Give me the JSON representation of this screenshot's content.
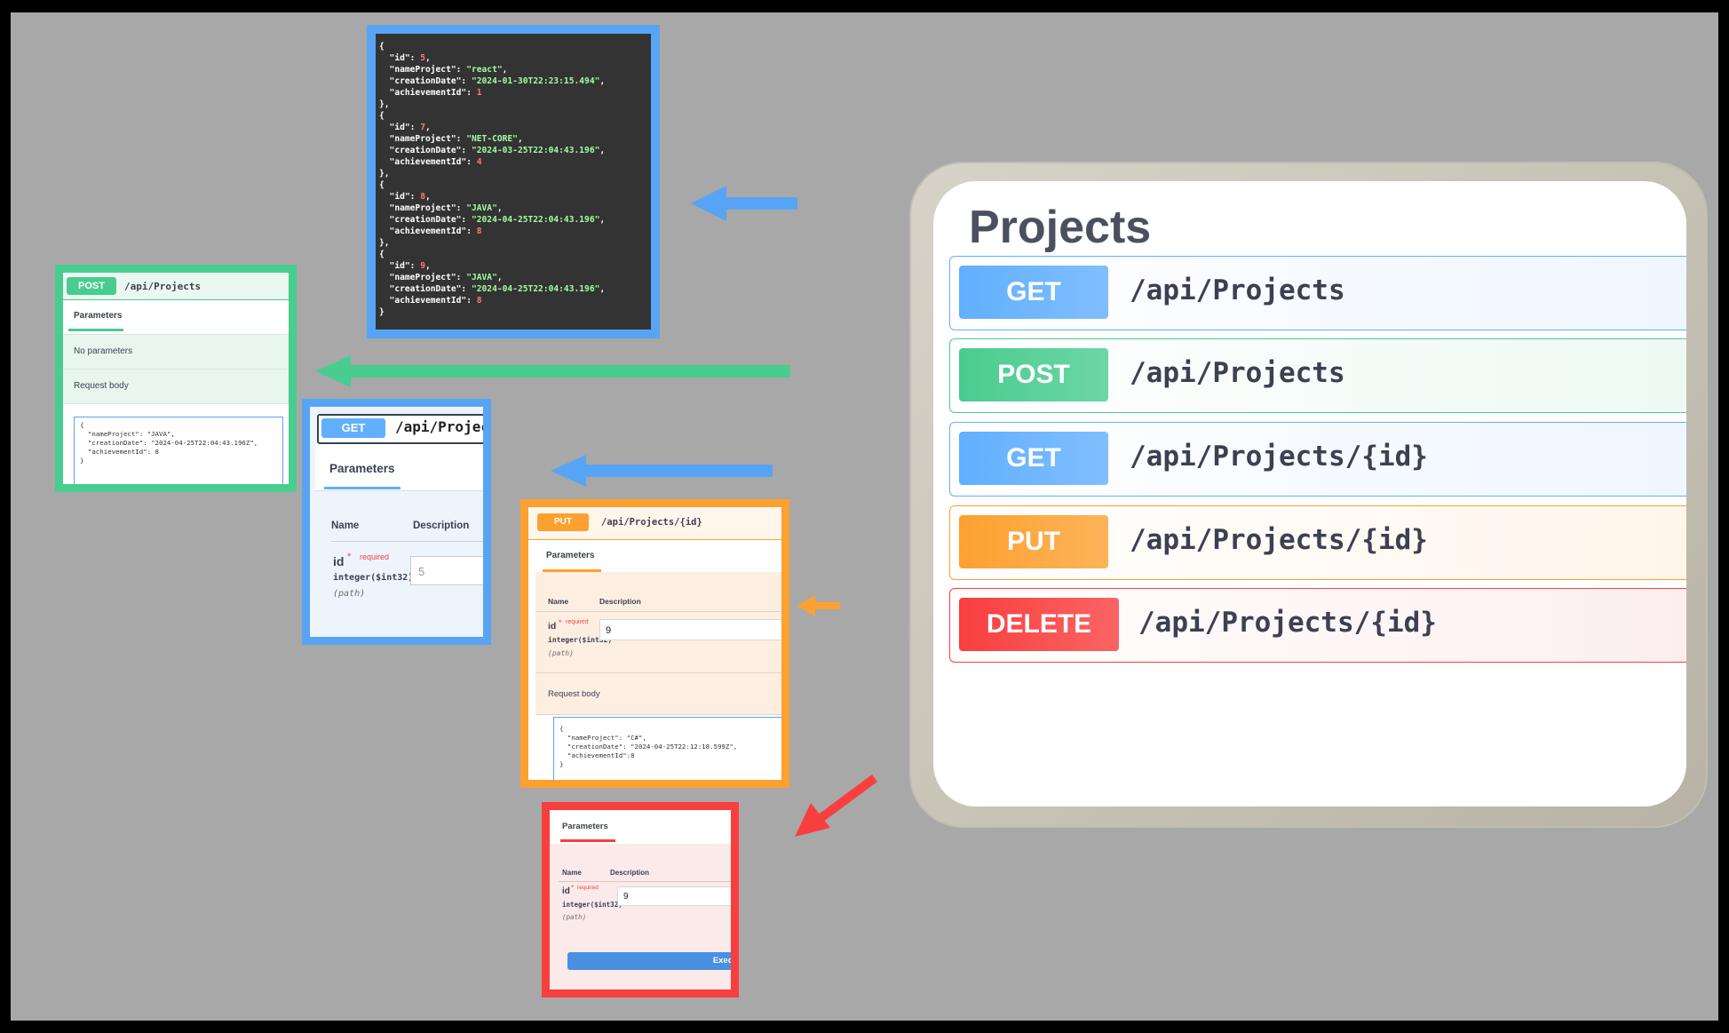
{
  "json_response": {
    "items": [
      {
        "id": "5",
        "nameProject": "\"react\"",
        "creationDate": "\"2024-01-30T22:23:15.494\"",
        "achievementId": "1"
      },
      {
        "id": "7",
        "nameProject": "\"NET-CORE\"",
        "creationDate": "\"2024-03-25T22:04:43.196\"",
        "achievementId": "4"
      },
      {
        "id": "8",
        "nameProject": "\"JAVA\"",
        "creationDate": "\"2024-04-25T22:04:43.196\"",
        "achievementId": "8"
      },
      {
        "id": "9",
        "nameProject": "\"JAVA\"",
        "creationDate": "\"2024-04-25T22:04:43.196\"",
        "achievementId": "8"
      }
    ]
  },
  "post_panel": {
    "method": "POST",
    "path": "/api/Projects",
    "tab": "Parameters",
    "no_params": "No parameters",
    "request_body_label": "Request body",
    "body_lines": [
      "{",
      "  \"nameProject\": \"JAVA\",",
      "  \"creationDate\": \"2024-04-25T22:04:43.196Z\",",
      "  \"achievementId\": 8",
      "}"
    ]
  },
  "get_id_panel": {
    "method": "GET",
    "path": "/api/Project",
    "tab": "Parameters",
    "col_name": "Name",
    "col_desc": "Description",
    "param_name": "id",
    "required_star": "*",
    "required": "required",
    "param_type": "integer($int32)",
    "param_in": "(path)",
    "input_value": "5"
  },
  "put_panel": {
    "method": "PUT",
    "path": "/api/Projects/{id}",
    "tab": "Parameters",
    "col_name": "Name",
    "col_desc": "Description",
    "param_name": "id",
    "required_star": "*",
    "required": "required",
    "param_type": "integer($int32)",
    "param_in": "(path)",
    "input_value": "9",
    "request_body_label": "Request body",
    "body_lines": [
      "{",
      "  \"nameProject\": \"C#\",",
      "  \"creationDate\": \"2024-04-25T22:12:18.599Z\",",
      "  \"achievementId\":8",
      "}"
    ]
  },
  "delete_panel": {
    "tab": "Parameters",
    "col_name": "Name",
    "col_desc": "Description",
    "param_name": "id",
    "required_star": "*",
    "required": "required",
    "param_type": "integer($int32)",
    "param_in": "(path)",
    "input_value": "9",
    "execute_label": "Exec"
  },
  "projects_card": {
    "title": "Projects",
    "operations": [
      {
        "method": "GET",
        "path": "/api/Projects",
        "color": "#61affe"
      },
      {
        "method": "POST",
        "path": "/api/Projects",
        "color": "#49cc90"
      },
      {
        "method": "GET",
        "path": "/api/Projects/{id}",
        "color": "#61affe"
      },
      {
        "method": "PUT",
        "path": "/api/Projects/{id}",
        "color": "#fca130"
      },
      {
        "method": "DELETE",
        "path": "/api/Projects/{id}",
        "color": "#f93e3e"
      }
    ]
  },
  "colors": {
    "get": "#61affe",
    "post": "#49cc90",
    "put": "#fca130",
    "delete": "#f93e3e",
    "background": "#a8a8a8"
  }
}
